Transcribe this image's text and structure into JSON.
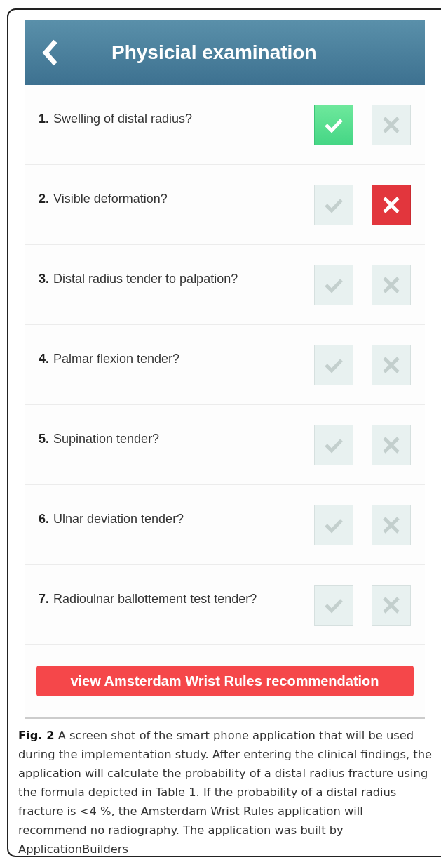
{
  "header": {
    "title": "Physicial examination"
  },
  "questions": [
    {
      "number": "1.",
      "text": "Swelling of distal radius?",
      "yes_selected": true,
      "no_selected": false
    },
    {
      "number": "2.",
      "text": "Visible deformation?",
      "yes_selected": false,
      "no_selected": true
    },
    {
      "number": "3.",
      "text": "Distal radius tender to palpation?",
      "yes_selected": false,
      "no_selected": false
    },
    {
      "number": "4.",
      "text": "Palmar flexion tender?",
      "yes_selected": false,
      "no_selected": false
    },
    {
      "number": "5.",
      "text": "Supination tender?",
      "yes_selected": false,
      "no_selected": false
    },
    {
      "number": "6.",
      "text": "Ulnar deviation tender?",
      "yes_selected": false,
      "no_selected": false
    },
    {
      "number": "7.",
      "text": "Radioulnar ballottement test tender?",
      "yes_selected": false,
      "no_selected": false
    }
  ],
  "action_button": "view Amsterdam Wrist Rules recommendation",
  "caption": "**Fig. 2** A screen shot of the smart phone application that will be used during the implementation study. After entering the clinical findings, the application will calculate the probability of a distal radius fracture using the formula depicted in Table 1. If the probability of a distal radius fracture is <4 %, the Amsterdam Wrist Rules application will recommend no radiography. The application was built by ApplicationBuilders"
}
